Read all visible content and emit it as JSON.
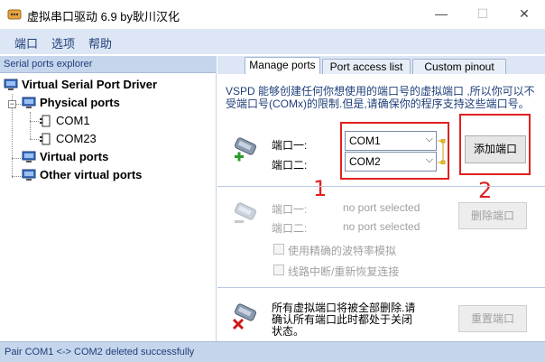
{
  "window": {
    "title": "虚拟串口驱动 6.9 by耿川汉化",
    "minimize": "—",
    "maximize": "☐",
    "close": "✕"
  },
  "menu": {
    "items": [
      "端口",
      "选项",
      "帮助"
    ]
  },
  "explorer": {
    "header": "Serial ports explorer",
    "root": "Virtual Serial Port Driver",
    "physical": "Physical ports",
    "ports": [
      "COM1",
      "COM23"
    ],
    "virtual": "Virtual ports",
    "other": "Other virtual ports"
  },
  "tabs": [
    "Manage ports",
    "Port access list",
    "Custom pinout"
  ],
  "manage": {
    "description": "VSPD 能够创建任何你想使用的端口号的虚拟端口 ,所以你可以不受端口号(COMx)的限制.但是,请确保你的程序支持这些端口号。",
    "port1_label": "端口一:",
    "port2_label": "端口二:",
    "port1_value": "COM1",
    "port2_value": "COM2",
    "add_button": "添加端口",
    "delete": {
      "port1_label": "端口一:",
      "port2_label": "端口二:",
      "port1_value": "no port selected",
      "port2_value": "no port selected",
      "button": "删除端口",
      "option1": "使用精确的波特率模拟",
      "option2": "线路中断/重新恢复连接"
    },
    "reset": {
      "text": "所有虚拟端口将被全部删除.请确认所有端口此时都处于关闭状态。",
      "button": "重置端口"
    }
  },
  "annotations": {
    "one": "1",
    "two": "2",
    "color": "#e02020"
  },
  "status": "Pair COM1 <-> COM2 deleted successfully",
  "icons": {
    "app": "serial-port-icon",
    "computer": "computer-icon",
    "port": "port-icon",
    "add": "add-pair-icon",
    "remove": "remove-pair-icon",
    "reset": "reset-icon"
  }
}
